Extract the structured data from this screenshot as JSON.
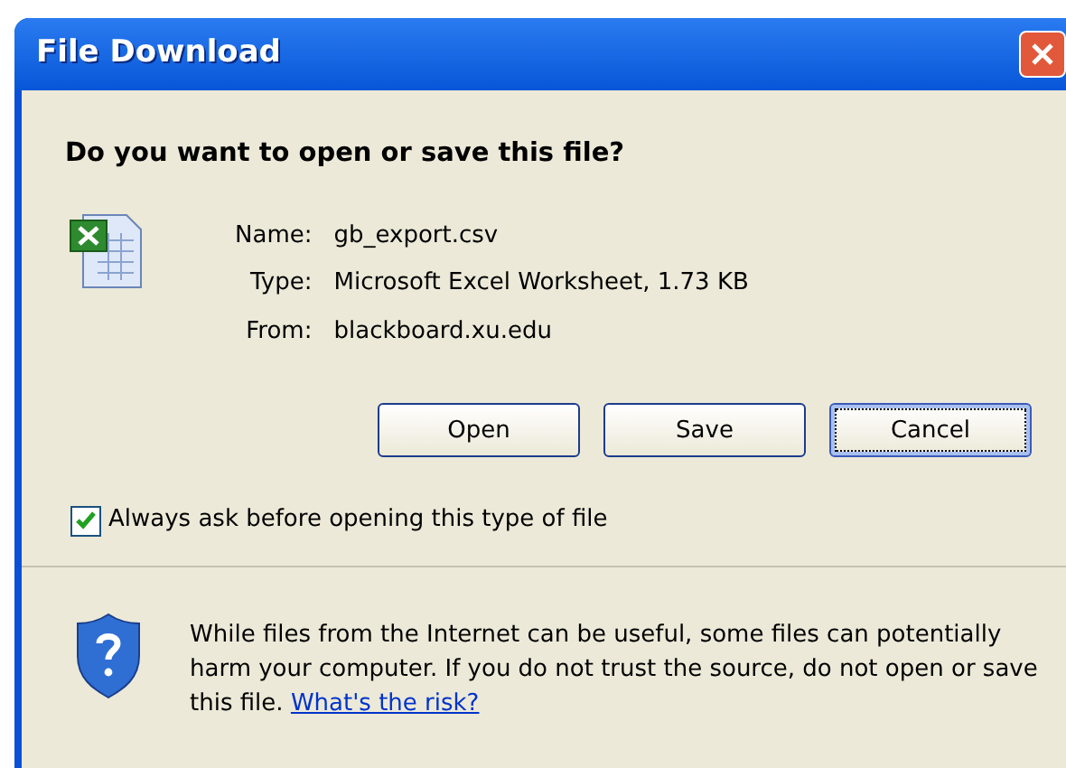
{
  "window": {
    "title": "File Download"
  },
  "question": "Do you want to open or save this file?",
  "file_info": [
    {
      "label": "Name:",
      "value": "gb_export.csv"
    },
    {
      "label": "Type:",
      "value": "Microsoft Excel Worksheet, 1.73 KB"
    },
    {
      "label": "From:",
      "value": "blackboard.xu.edu"
    }
  ],
  "buttons": [
    {
      "label": "Open",
      "focused": false
    },
    {
      "label": "Save",
      "focused": false
    },
    {
      "label": "Cancel",
      "focused": true
    }
  ],
  "always_ask": {
    "label": "Always ask before opening this type of file",
    "checked": true
  },
  "warning": {
    "text": "While files from the Internet can be useful, some files can potentially harm your computer. If you do not trust the source, do not open or save this file.",
    "link": "What's the risk?"
  }
}
